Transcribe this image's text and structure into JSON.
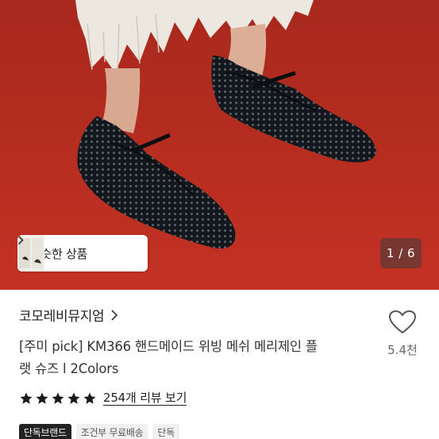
{
  "hero": {
    "similar_label": "비슷한 상품",
    "counter": "1 / 6"
  },
  "product": {
    "brand": "코모레비뮤지엄",
    "title_line1": "[주미 pick] KM366 핸드메이드 위빙 메쉬 메리제인 플",
    "title_line2": "랫 슈즈 l 2Colors",
    "like_count": "5.4천",
    "stars": 5,
    "review_link": "254개 리뷰 보기",
    "tags": [
      "단독브랜드",
      "조건부 무료배송",
      "단독"
    ]
  },
  "colors": {
    "floor": "#b52a1f",
    "shoe": "#14181c",
    "star": "#1a1a1a"
  },
  "icons": {
    "similar_chevron": "chevron-right-icon",
    "brand_chevron": "chevron-right-icon",
    "like": "heart-outline-icon",
    "rating": "star-icon"
  }
}
